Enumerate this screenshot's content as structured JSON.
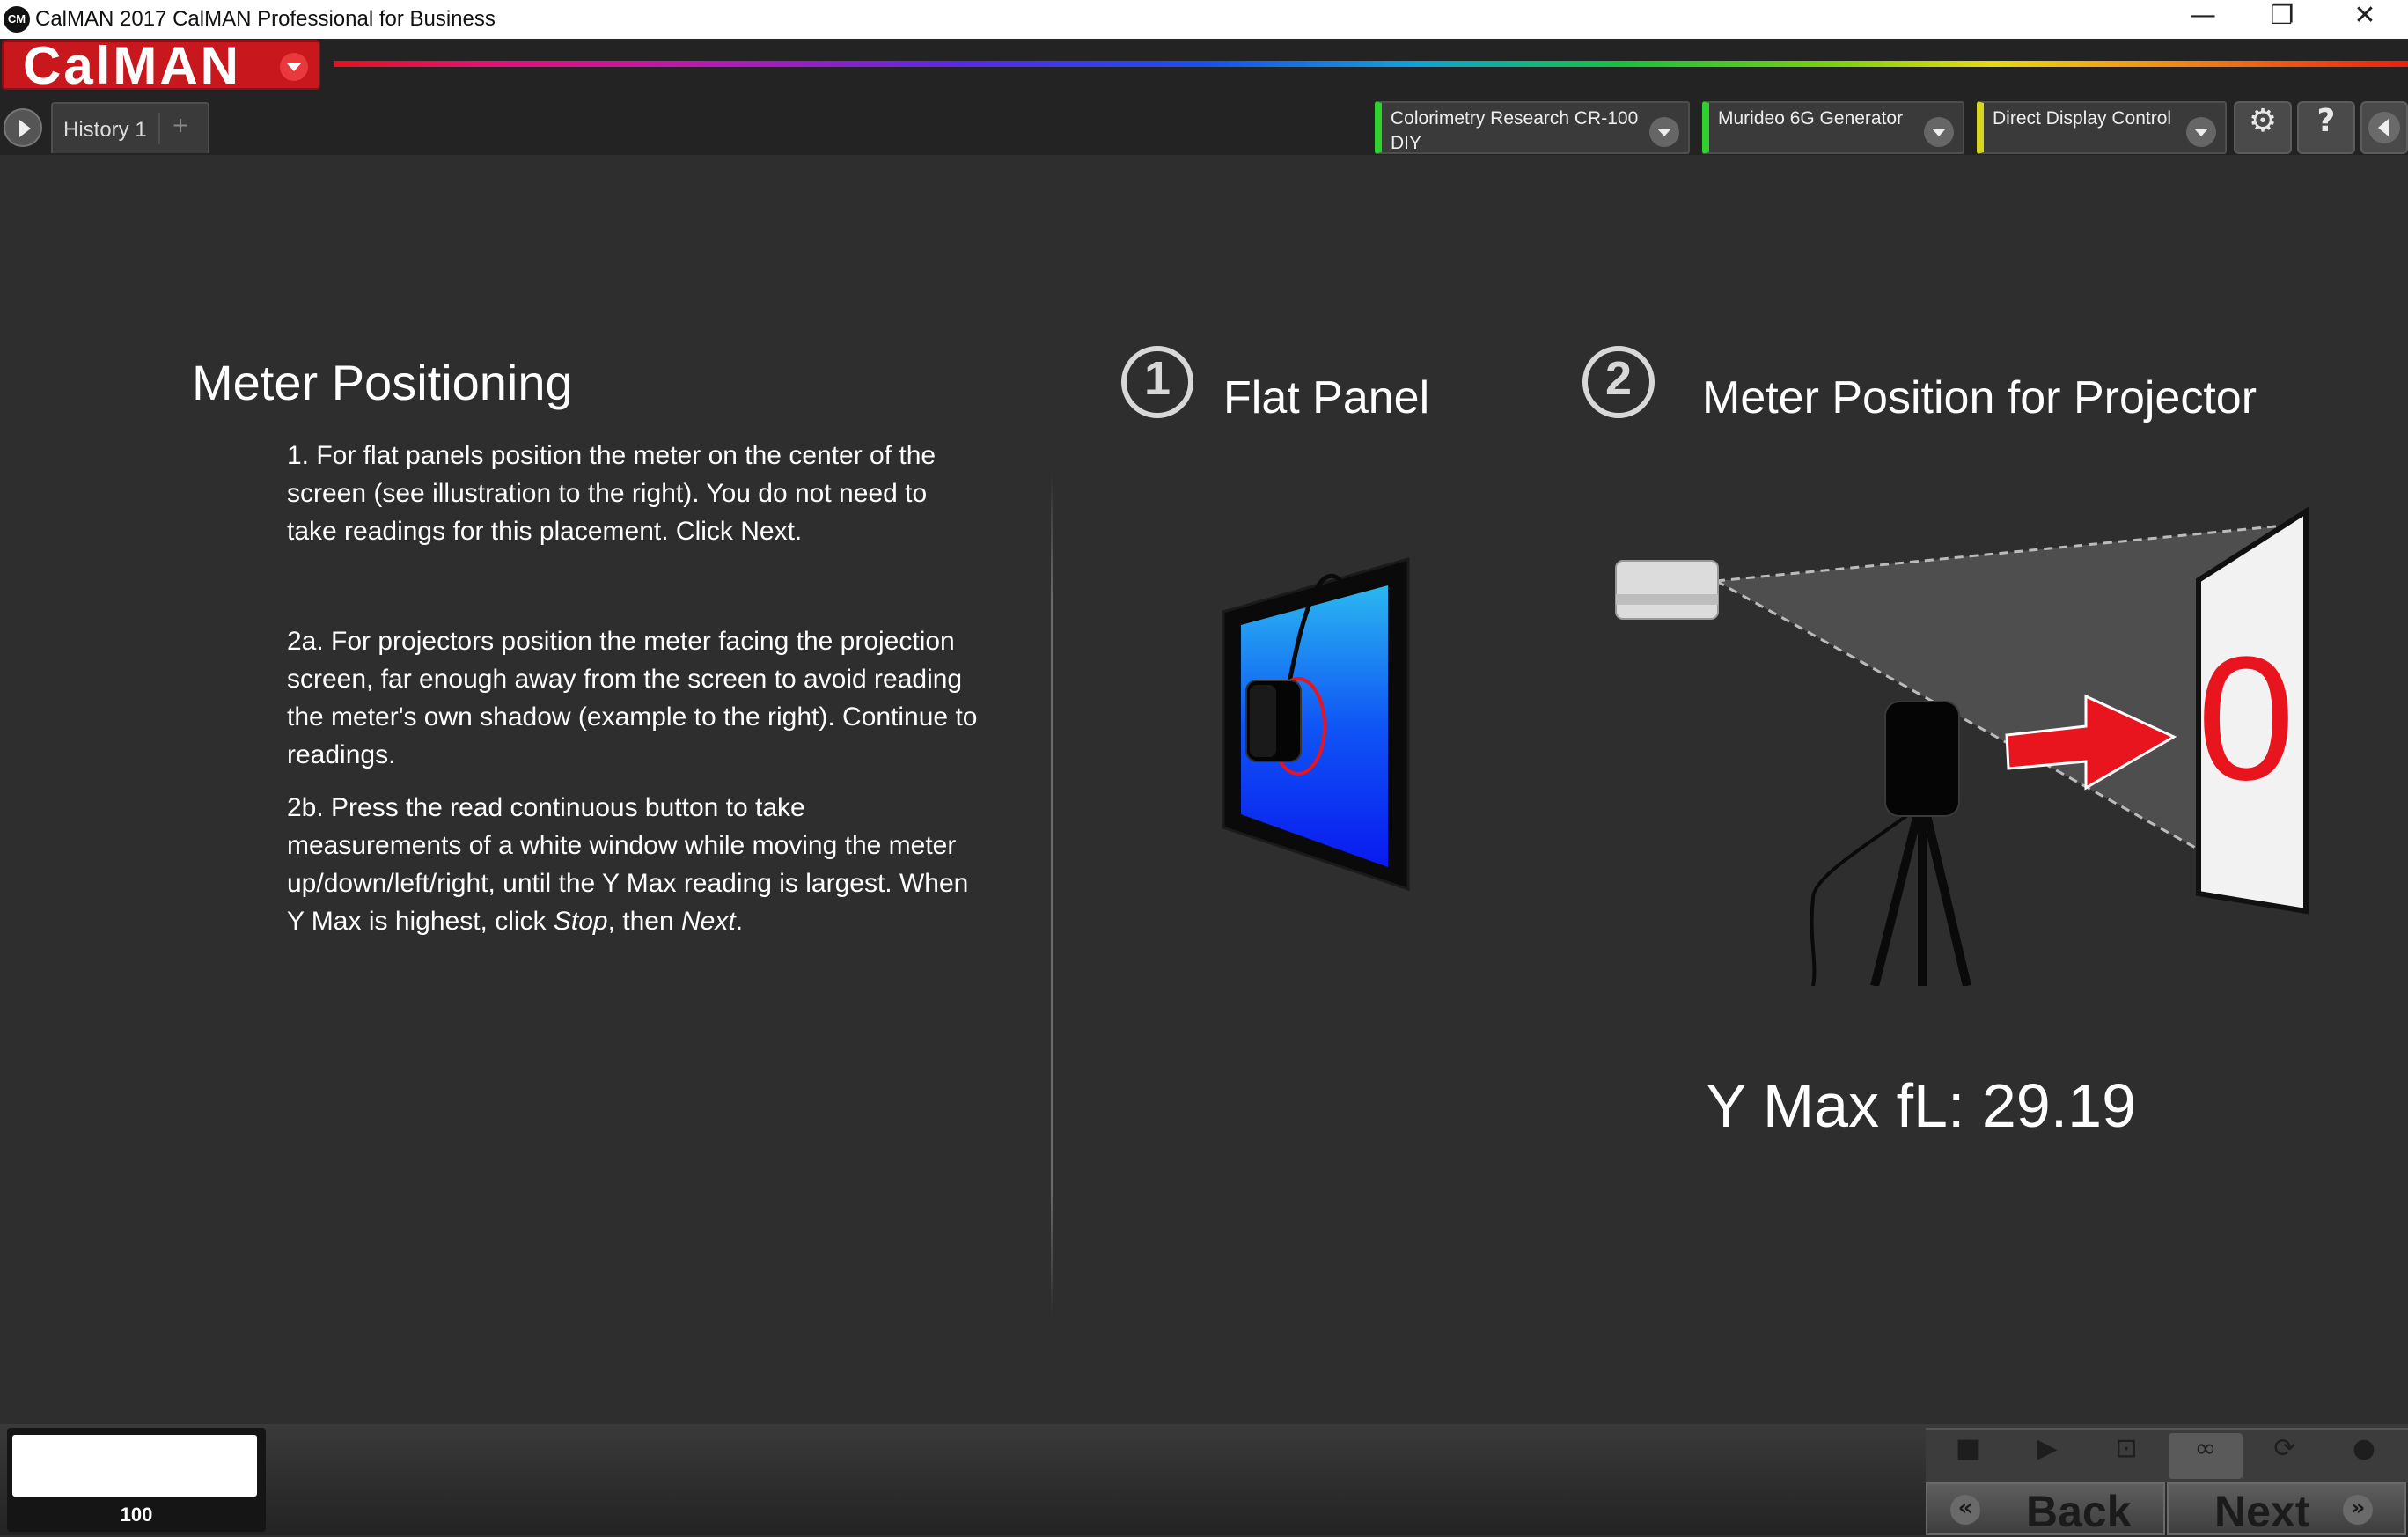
{
  "window": {
    "icon_text": "CM",
    "title": "CalMAN 2017 CalMAN Professional for Business",
    "minimize": "—",
    "restore": "❐",
    "close": "✕"
  },
  "header": {
    "logo": "CalMAN",
    "tab": "History 1",
    "tab_add": "+",
    "devices": [
      {
        "label": "Colorimetry Research CR-100\nDIY",
        "status_color": "#2fd12f"
      },
      {
        "label": "Murideo 6G Generator",
        "status_color": "#2fd12f"
      },
      {
        "label": "Direct Display Control",
        "status_color": "#d6d622"
      }
    ],
    "buttons": {
      "settings": "⚙",
      "help": "?"
    }
  },
  "content": {
    "heading": "Meter Positioning",
    "instructions": [
      "1. For flat panels position the meter on the center of the screen (see illustration to the right).  You do not need to take readings for this placement.  Click Next.",
      "2a. For projectors position the meter facing the projection screen, far enough away from the screen to avoid reading the meter's own shadow (example to the right).  Continue to readings."
    ],
    "step_2b": {
      "text": "2b. Press the read continuous button to take measurements of a white window while moving the meter up/down/left/right, until the Y Max reading is largest. When Y Max is highest, click ",
      "stop": "Stop",
      "then": ", then ",
      "next": "Next",
      "end": "."
    },
    "section1": {
      "number": "1",
      "title": "Flat Panel"
    },
    "section2": {
      "number": "2",
      "title": "Meter Position for Projector"
    },
    "ymax_label": "Y Max fL: 29.19",
    "screen_text": "0"
  },
  "footer": {
    "thumbnail_value": "100",
    "controls": {
      "stop": "■",
      "play": "▶",
      "step": "⊡",
      "loop": "∞",
      "refresh": "⟳",
      "record": "●"
    },
    "back_label": "Back",
    "next_label": "Next",
    "back_icon": "«",
    "next_icon": "»"
  },
  "colors": {
    "accent_red": "#c8181e",
    "background": "#2e2e2e"
  }
}
